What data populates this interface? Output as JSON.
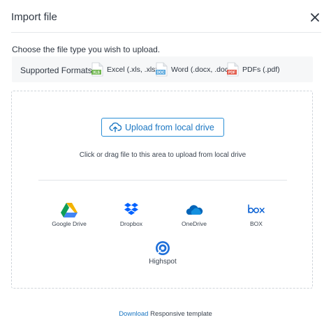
{
  "header": {
    "title": "Import file"
  },
  "subtitle": "Choose the file type you wish to upload.",
  "formats": {
    "label": "Supported Formats:",
    "items": [
      {
        "badge": "XLS",
        "label": "Excel (.xls, .xlsx)",
        "color": "#6fb64f"
      },
      {
        "badge": "DOC",
        "label": "Word (.docx, .doc)",
        "color": "#5aa7dc"
      },
      {
        "badge": "PDF",
        "label": "PDFs (.pdf)",
        "color": "#e25b4c"
      }
    ]
  },
  "dropzone": {
    "upload_label": "Upload from local drive",
    "hint": "Click or drag file to this area to upload from local drive",
    "sources": [
      {
        "name": "Google Drive",
        "icon": "google-drive-icon"
      },
      {
        "name": "Dropbox",
        "icon": "dropbox-icon"
      },
      {
        "name": "OneDrive",
        "icon": "onedrive-icon"
      },
      {
        "name": "BOX",
        "icon": "box-icon"
      },
      {
        "name": "Highspot",
        "icon": "highspot-icon"
      }
    ]
  },
  "footer": {
    "link": "Download",
    "text": " Responsive template"
  },
  "colors": {
    "accent": "#1a76c2",
    "border": "#2b8fd6",
    "panel": "#f6f7f8"
  }
}
